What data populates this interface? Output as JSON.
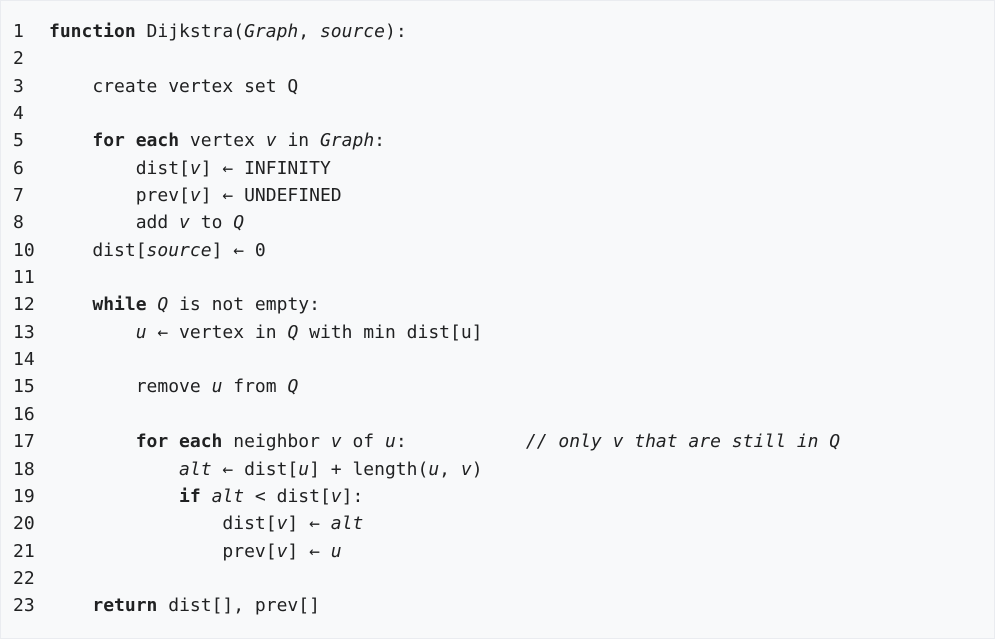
{
  "lines": [
    {
      "num": "1",
      "segments": [
        {
          "t": "function",
          "s": "kw"
        },
        {
          "t": " Dijkstra(",
          "s": ""
        },
        {
          "t": "Graph",
          "s": "it"
        },
        {
          "t": ", ",
          "s": ""
        },
        {
          "t": "source",
          "s": "it"
        },
        {
          "t": "):",
          "s": ""
        }
      ]
    },
    {
      "num": "2",
      "segments": []
    },
    {
      "num": "3",
      "segments": [
        {
          "t": "    create vertex set Q",
          "s": ""
        }
      ]
    },
    {
      "num": "4",
      "segments": []
    },
    {
      "num": "5",
      "segments": [
        {
          "t": "    ",
          "s": ""
        },
        {
          "t": "for each",
          "s": "kw"
        },
        {
          "t": " vertex ",
          "s": ""
        },
        {
          "t": "v",
          "s": "it"
        },
        {
          "t": " in ",
          "s": ""
        },
        {
          "t": "Graph",
          "s": "it"
        },
        {
          "t": ":",
          "s": ""
        }
      ]
    },
    {
      "num": "6",
      "segments": [
        {
          "t": "        dist[",
          "s": ""
        },
        {
          "t": "v",
          "s": "it"
        },
        {
          "t": "] ← INFINITY",
          "s": ""
        }
      ]
    },
    {
      "num": "7",
      "segments": [
        {
          "t": "        prev[",
          "s": ""
        },
        {
          "t": "v",
          "s": "it"
        },
        {
          "t": "] ← UNDEFINED",
          "s": ""
        }
      ]
    },
    {
      "num": "8",
      "segments": [
        {
          "t": "        add ",
          "s": ""
        },
        {
          "t": "v",
          "s": "it"
        },
        {
          "t": " to ",
          "s": ""
        },
        {
          "t": "Q",
          "s": "it"
        }
      ]
    },
    {
      "num": "10",
      "segments": [
        {
          "t": "    dist[",
          "s": ""
        },
        {
          "t": "source",
          "s": "it"
        },
        {
          "t": "] ← 0",
          "s": ""
        }
      ]
    },
    {
      "num": "11",
      "segments": []
    },
    {
      "num": "12",
      "segments": [
        {
          "t": "    ",
          "s": ""
        },
        {
          "t": "while",
          "s": "kw"
        },
        {
          "t": " ",
          "s": ""
        },
        {
          "t": "Q",
          "s": "it"
        },
        {
          "t": " is not empty:",
          "s": ""
        }
      ]
    },
    {
      "num": "13",
      "segments": [
        {
          "t": "        ",
          "s": ""
        },
        {
          "t": "u",
          "s": "it"
        },
        {
          "t": " ← vertex in ",
          "s": ""
        },
        {
          "t": "Q",
          "s": "it"
        },
        {
          "t": " with min dist[u]",
          "s": ""
        }
      ]
    },
    {
      "num": "14",
      "segments": []
    },
    {
      "num": "15",
      "segments": [
        {
          "t": "        remove ",
          "s": ""
        },
        {
          "t": "u",
          "s": "it"
        },
        {
          "t": " from ",
          "s": ""
        },
        {
          "t": "Q",
          "s": "it"
        }
      ]
    },
    {
      "num": "16",
      "segments": []
    },
    {
      "num": "17",
      "segments": [
        {
          "t": "        ",
          "s": ""
        },
        {
          "t": "for each",
          "s": "kw"
        },
        {
          "t": " neighbor ",
          "s": ""
        },
        {
          "t": "v",
          "s": "it"
        },
        {
          "t": " of ",
          "s": ""
        },
        {
          "t": "u",
          "s": "it"
        },
        {
          "t": ":           ",
          "s": ""
        },
        {
          "t": "// only v that are still in Q",
          "s": "comment"
        }
      ]
    },
    {
      "num": "18",
      "segments": [
        {
          "t": "            ",
          "s": ""
        },
        {
          "t": "alt",
          "s": "it"
        },
        {
          "t": " ← dist[",
          "s": ""
        },
        {
          "t": "u",
          "s": "it"
        },
        {
          "t": "] + length(",
          "s": ""
        },
        {
          "t": "u",
          "s": "it"
        },
        {
          "t": ", ",
          "s": ""
        },
        {
          "t": "v",
          "s": "it"
        },
        {
          "t": ")",
          "s": ""
        }
      ]
    },
    {
      "num": "19",
      "segments": [
        {
          "t": "            ",
          "s": ""
        },
        {
          "t": "if",
          "s": "kw"
        },
        {
          "t": " ",
          "s": ""
        },
        {
          "t": "alt",
          "s": "it"
        },
        {
          "t": " < dist[",
          "s": ""
        },
        {
          "t": "v",
          "s": "it"
        },
        {
          "t": "]:",
          "s": ""
        }
      ]
    },
    {
      "num": "20",
      "segments": [
        {
          "t": "                dist[",
          "s": ""
        },
        {
          "t": "v",
          "s": "it"
        },
        {
          "t": "] ← ",
          "s": ""
        },
        {
          "t": "alt",
          "s": "it"
        }
      ]
    },
    {
      "num": "21",
      "segments": [
        {
          "t": "                prev[",
          "s": ""
        },
        {
          "t": "v",
          "s": "it"
        },
        {
          "t": "] ← ",
          "s": ""
        },
        {
          "t": "u",
          "s": "it"
        }
      ]
    },
    {
      "num": "22",
      "segments": []
    },
    {
      "num": "23",
      "segments": [
        {
          "t": "    ",
          "s": ""
        },
        {
          "t": "return",
          "s": "kw"
        },
        {
          "t": " dist[], prev[]",
          "s": ""
        }
      ]
    }
  ]
}
